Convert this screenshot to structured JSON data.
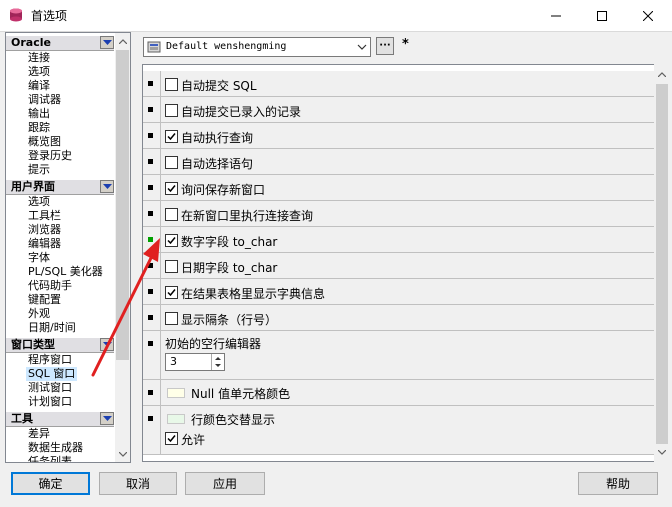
{
  "window": {
    "title": "首选项",
    "controls": [
      "minimize-icon",
      "maximize-icon",
      "close-icon"
    ]
  },
  "tree": {
    "categories": [
      {
        "label": "Oracle",
        "items": [
          "连接",
          "选项",
          "编译",
          "调试器",
          "输出",
          "跟踪",
          "概览图",
          "登录历史",
          "提示"
        ]
      },
      {
        "label": "用户界面",
        "items": [
          "选项",
          "工具栏",
          "浏览器",
          "编辑器",
          "字体",
          "PL/SQL 美化器",
          "代码助手",
          "键配置",
          "外观",
          "日期/时间"
        ]
      },
      {
        "label": "窗口类型",
        "items": [
          "程序窗口",
          "SQL 窗口",
          "测试窗口",
          "计划窗口"
        ]
      },
      {
        "label": "工具",
        "items": [
          "差异",
          "数据生成器",
          "任务列表"
        ]
      }
    ],
    "selected": "SQL 窗口"
  },
  "toolbar": {
    "template_value": "Default wenshengming",
    "dots_label": "···",
    "modified_mark": "*"
  },
  "options": {
    "auto_commit": {
      "label": "自动提交 SQL",
      "checked": false
    },
    "auto_commit_loaded": {
      "label": "自动提交已录入的记录",
      "checked": false
    },
    "auto_execute_query": {
      "label": "自动执行查询",
      "checked": true
    },
    "auto_select_statement": {
      "label": "自动选择语句",
      "checked": false
    },
    "ask_save_new_window": {
      "label": "询问保存新窗口",
      "checked": true
    },
    "new_window_connection_query": {
      "label": "在新窗口里执行连接查询",
      "checked": false
    },
    "number_field_to_char": {
      "label": "数字字段 to_char",
      "checked": true
    },
    "date_field_to_char": {
      "label": "日期字段 to_char",
      "checked": false
    },
    "show_dictionary_info": {
      "label": "在结果表格里显示字典信息",
      "checked": true
    },
    "show_gridlines": {
      "label": "显示隔条（行号）",
      "checked": false
    },
    "initial_empty_editors": {
      "label": "初始的空行编辑器",
      "value": "3"
    },
    "null_cell_color": {
      "label": "Null 值单元格颜色",
      "color": "#ffffe8"
    },
    "row_alt_color": {
      "label": "行颜色交替显示",
      "color": "#e8f8e8"
    },
    "allow": {
      "label": "允许",
      "checked": true
    }
  },
  "buttons": {
    "ok": "确定",
    "cancel": "取消",
    "apply": "应用",
    "help": "帮助"
  },
  "colors": {
    "annotation_arrow": "#e02020",
    "selection": "#cde8ff",
    "focus_border": "#0078d7"
  }
}
